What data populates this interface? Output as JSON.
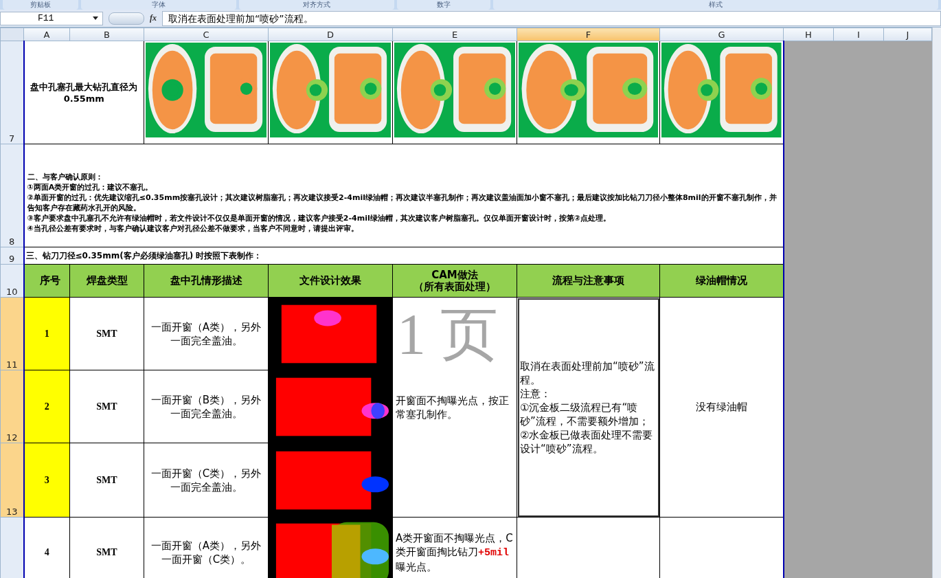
{
  "ribbon_groups": [
    "剪贴板",
    "字体",
    "对齐方式",
    "数字",
    "样式"
  ],
  "formula_bar": {
    "name_box": "F11",
    "fx": "fx",
    "formula": "取消在表面处理前加“喷砂”流程。"
  },
  "columns": [
    {
      "label": "A",
      "selected": false
    },
    {
      "label": "B",
      "selected": false
    },
    {
      "label": "C",
      "selected": false
    },
    {
      "label": "D",
      "selected": false
    },
    {
      "label": "E",
      "selected": false
    },
    {
      "label": "F",
      "selected": true
    },
    {
      "label": "G",
      "selected": false
    },
    {
      "label": "H",
      "selected": false
    },
    {
      "label": "I",
      "selected": false
    },
    {
      "label": "J",
      "selected": false
    }
  ],
  "row_numbers": [
    {
      "label": "7",
      "selected": false
    },
    {
      "label": "8",
      "selected": false
    },
    {
      "label": "9",
      "selected": false
    },
    {
      "label": "10",
      "selected": false
    },
    {
      "label": "11",
      "selected": true
    },
    {
      "label": "12",
      "selected": true
    },
    {
      "label": "13",
      "selected": true
    }
  ],
  "row_7": {
    "title": "盘中孔塞孔最大钻孔直径为0.55mm"
  },
  "row_8": {
    "lines": [
      "二、与客户确认原则：",
      "①两面A类开窗的过孔：建议不塞孔。",
      "②单面开窗的过孔：优先建议缩孔≤0.35mm按塞孔设计；其次建议树脂塞孔；再次建议接受2-4mil绿油帽；再次建议半塞孔制作；再次建议盖油面加小窗不塞孔；最后建议按加比钻刀刀径小整体8mil的开窗不塞孔制作，并告知客户存在藏药水孔开的风险。",
      "③客户要求盘中孔塞孔不允许有绿油帽时，若文件设计不仅仅是单面开窗的情况，建议客户接受2-4mil绿油帽，其次建议客户树脂塞孔。仅仅单面开窗设计时，按第②点处理。",
      "④当孔径公差有要求时，与客户确认建议客户对孔径公差不做要求，当客户不同意时，请提出评审。"
    ]
  },
  "row_9": {
    "heading": "三、钻刀刀径≤0.35mm(客户必须绿油塞孔) 时按照下表制作："
  },
  "table": {
    "columns": [
      "序号",
      "焊盘类型",
      "盘中孔情形描述",
      "文件设计效果",
      "CAM做法（所有表面处理）",
      "流程与注意事项",
      "绿油帽情况"
    ],
    "group": {
      "cam": "开窗面不掏曝光点，按正常塞孔制作。",
      "notes": [
        "取消在表面处理前加“喷砂”流程。",
        "注意：",
        "①沉金板二级流程已有“喷砂”流程，不需要额外增加；",
        "②水金板已做表面处理不需要设计“喷砂”流程。"
      ],
      "notes_selected": true,
      "green_cap": "没有绿油帽"
    },
    "rows": [
      {
        "seq": "1",
        "highlighted": true,
        "pad_type": "SMT",
        "description": "一面开窗（A类），另外一面完全盖油。"
      },
      {
        "seq": "2",
        "highlighted": true,
        "pad_type": "SMT",
        "description": "一面开窗（B类），另外一面完全盖油。"
      },
      {
        "seq": "3",
        "highlighted": true,
        "pad_type": "SMT",
        "description": "一面开窗（C类），另外一面完全盖油。"
      },
      {
        "seq": "4",
        "highlighted": false,
        "pad_type": "SMT",
        "description": "一面开窗（A类），另外一面开窗（C类）。",
        "cam": "A类开窗面不掏曝光点，C类开窗面掏比钻刀**+5mil**曝光点。"
      }
    ]
  },
  "page_watermark": "1 页"
}
